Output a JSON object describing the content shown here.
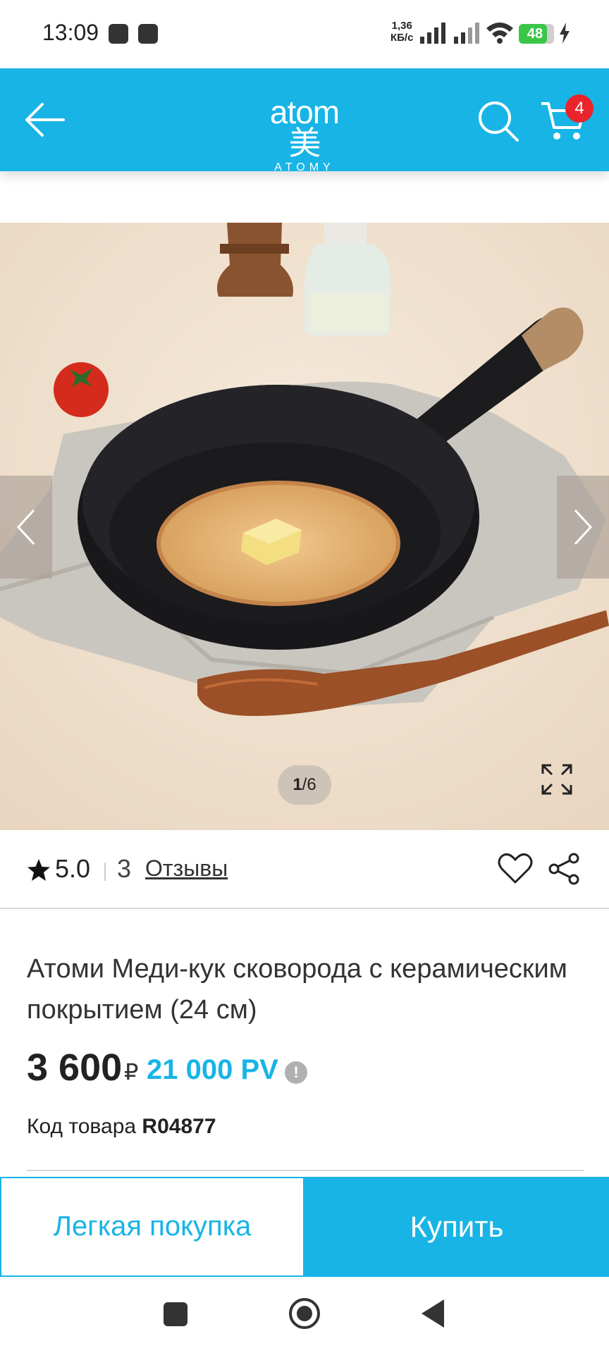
{
  "status_bar": {
    "time": "13:09",
    "net_speed_value": "1,36",
    "net_speed_unit": "КБ/с",
    "battery": "48",
    "battery_level": 0.48
  },
  "header": {
    "logo_text": "atom美",
    "logo_sub": "ATOMY",
    "cart_count": "4",
    "brand_color": "#18b4e6"
  },
  "gallery": {
    "page_current": "1",
    "page_total": "/6"
  },
  "rating": {
    "value": "5.0",
    "count": "3",
    "reviews_label": "Отзывы"
  },
  "product": {
    "title": "Атоми Меди-кук сковорода с керамическим покрытием (24 см)",
    "price": "3 600",
    "currency": "₽",
    "pv": "21 000 PV",
    "info_icon": "!",
    "sku_label": "Код товара ",
    "sku_value": "R04877"
  },
  "actions": {
    "easy_buy": "Легкая покупка",
    "buy": "Купить"
  },
  "icons": {
    "back": "back-arrow-icon",
    "search": "search-icon",
    "cart": "cart-icon",
    "heart": "heart-icon",
    "share": "share-icon",
    "fullscreen": "fullscreen-icon",
    "star": "star-icon"
  }
}
